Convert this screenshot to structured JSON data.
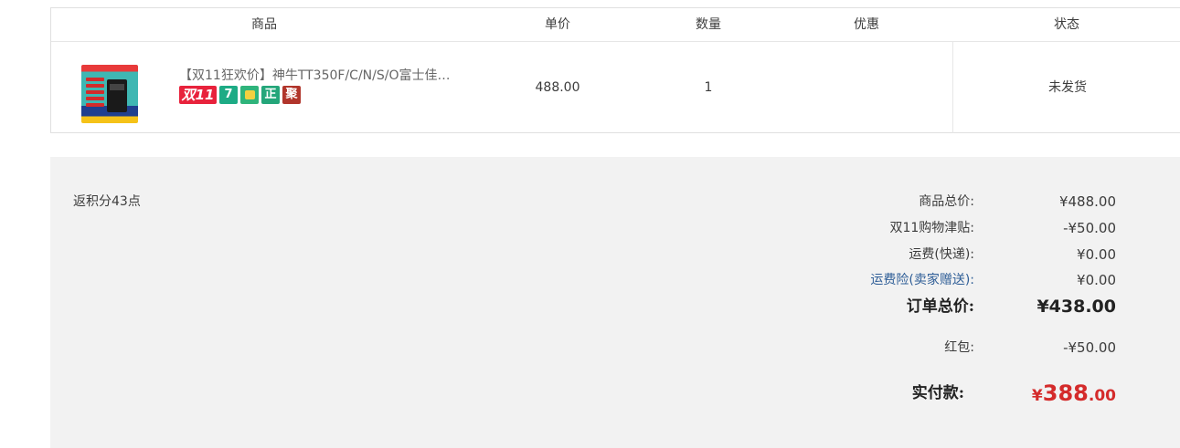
{
  "table": {
    "headers": [
      "商品",
      "单价",
      "数量",
      "优惠",
      "状态"
    ],
    "item": {
      "title": "【双11狂欢价】神牛TT350F/C/N/S/O富士佳…",
      "badges": [
        "双11",
        "7",
        "bag",
        "正",
        "聚"
      ],
      "price": "488.00",
      "quantity": "1",
      "discount": "",
      "status": "未发货"
    }
  },
  "summary": {
    "points": "返积分43点",
    "rows": [
      {
        "label": "商品总价:",
        "value": "¥488.00"
      },
      {
        "label": "双11购物津贴:",
        "value": "-¥50.00"
      },
      {
        "label": "运费(快递):",
        "value": "¥0.00"
      },
      {
        "label": "运费险(卖家赠送):",
        "value": "¥0.00"
      }
    ],
    "total": {
      "label": "订单总价:",
      "value": "¥438.00"
    },
    "redpacket": {
      "label": "红包:",
      "value": "-¥50.00"
    },
    "paid": {
      "label": "实付款:",
      "currency": "¥",
      "integer": "388",
      "decimal": ".00"
    }
  },
  "colors": {
    "accent_red": "#d42b2b",
    "link_blue": "#2f5e97",
    "summary_bg": "#f2f2f2"
  }
}
